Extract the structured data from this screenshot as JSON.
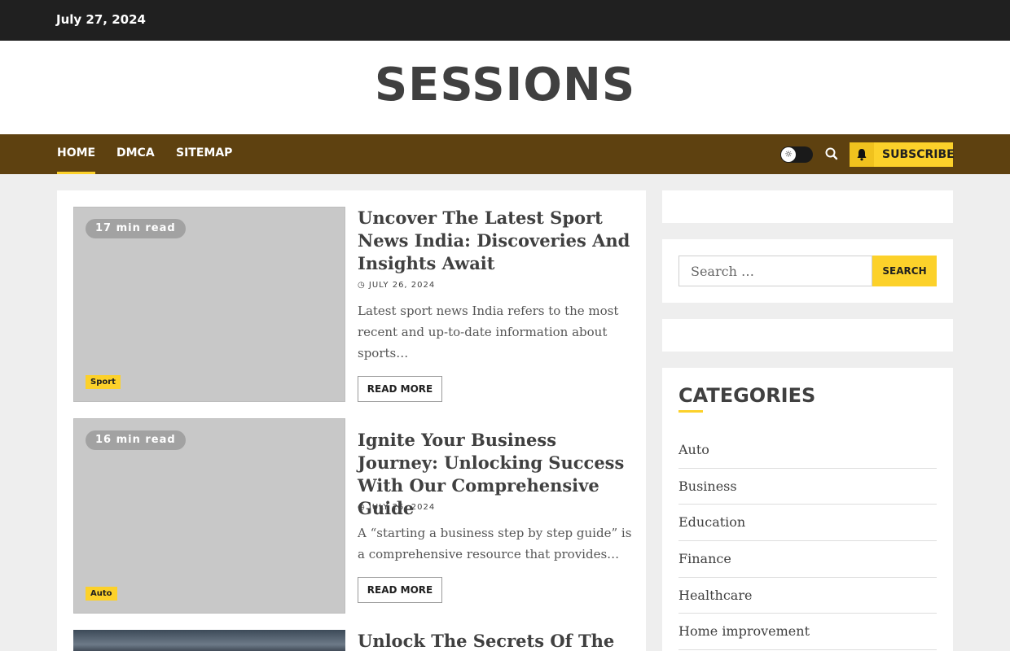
{
  "topbar": {
    "date": "July 27, 2024"
  },
  "site": {
    "title": "SESSIONS"
  },
  "nav": {
    "items": [
      {
        "label": "Home"
      },
      {
        "label": "DMCA"
      },
      {
        "label": "Sitemap"
      }
    ],
    "active": "Home",
    "subscribe_label": "Subscribe",
    "toggle_icon": "sun-icon",
    "search_icon": "search-icon",
    "accent_color": "#fcd12a",
    "nav_color": "#5e4110"
  },
  "posts": [
    {
      "read_time": "17 min read",
      "category": "Sport",
      "title": "Uncover The Latest Sport News India: Discoveries And Insights Await",
      "date": "July 26, 2024",
      "excerpt": "Latest sport news India refers to the most recent and up-to-date information about sports…",
      "read_more": "Read More"
    },
    {
      "read_time": "16 min read",
      "category": "Auto",
      "title": "Ignite Your Business Journey: Unlocking Success With Our Comprehensive Guide",
      "date": "July 25, 2024",
      "excerpt": "A “starting a business step by step guide” is a comprehensive resource that provides…",
      "read_more": "Read More"
    },
    {
      "title": "Unlock The Secrets Of The Real"
    }
  ],
  "sidebar": {
    "search": {
      "placeholder": "Search …",
      "button": "Search"
    },
    "categories_heading": "Categories",
    "categories": [
      "Auto",
      "Business",
      "Education",
      "Finance",
      "Healthcare",
      "Home improvement"
    ]
  }
}
